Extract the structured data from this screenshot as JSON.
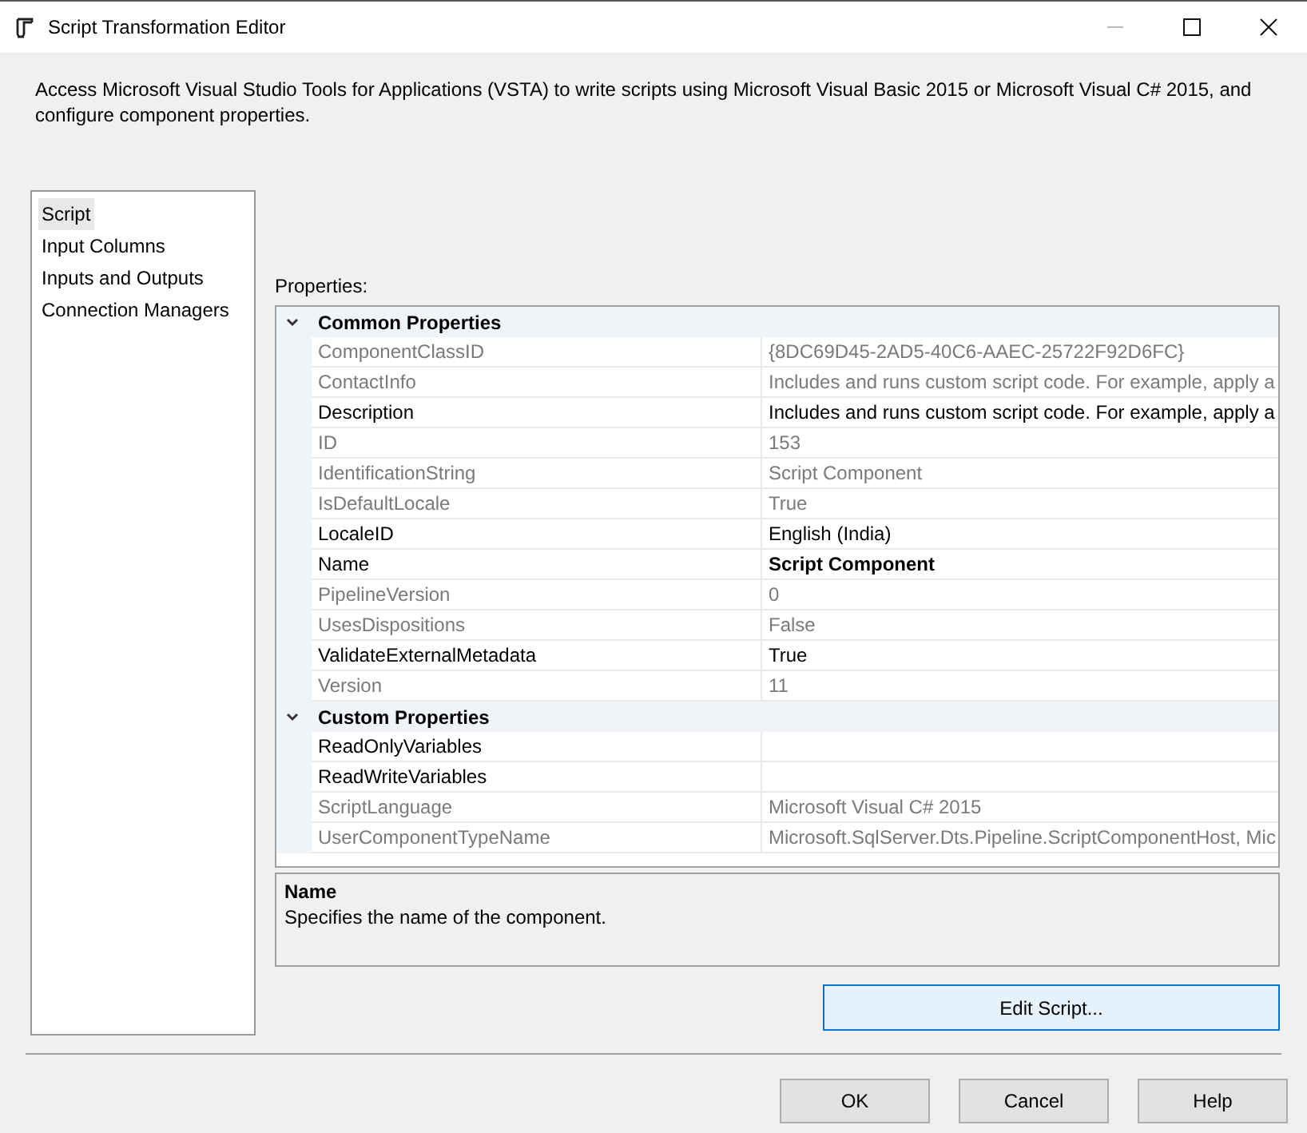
{
  "window": {
    "title": "Script Transformation Editor"
  },
  "description": "Access Microsoft Visual Studio Tools for Applications (VSTA) to write scripts using Microsoft Visual Basic 2015 or Microsoft Visual C# 2015, and configure component properties.",
  "sidebar": {
    "items": [
      {
        "label": "Script",
        "selected": true
      },
      {
        "label": "Input Columns",
        "selected": false
      },
      {
        "label": "Inputs and Outputs",
        "selected": false
      },
      {
        "label": "Connection Managers",
        "selected": false
      }
    ]
  },
  "properties": {
    "label": "Properties:",
    "sections": [
      {
        "title": "Common Properties",
        "expanded": true,
        "rows": [
          {
            "name": "ComponentClassID",
            "value": "{8DC69D45-2AD5-40C6-AAEC-25722F92D6FC}",
            "disabled": true,
            "bold": false
          },
          {
            "name": "ContactInfo",
            "value": "Includes and runs custom script code. For example, apply a",
            "disabled": true,
            "bold": false
          },
          {
            "name": "Description",
            "value": "Includes and runs custom script code. For example, apply a",
            "disabled": false,
            "bold": false
          },
          {
            "name": "ID",
            "value": "153",
            "disabled": true,
            "bold": false
          },
          {
            "name": "IdentificationString",
            "value": "Script Component",
            "disabled": true,
            "bold": false
          },
          {
            "name": "IsDefaultLocale",
            "value": "True",
            "disabled": true,
            "bold": false
          },
          {
            "name": "LocaleID",
            "value": "English (India)",
            "disabled": false,
            "bold": false
          },
          {
            "name": "Name",
            "value": "Script Component",
            "disabled": false,
            "bold": true
          },
          {
            "name": "PipelineVersion",
            "value": "0",
            "disabled": true,
            "bold": false
          },
          {
            "name": "UsesDispositions",
            "value": "False",
            "disabled": true,
            "bold": false
          },
          {
            "name": "ValidateExternalMetadata",
            "value": "True",
            "disabled": false,
            "bold": false
          },
          {
            "name": "Version",
            "value": "11",
            "disabled": true,
            "bold": false
          }
        ]
      },
      {
        "title": "Custom Properties",
        "expanded": true,
        "rows": [
          {
            "name": "ReadOnlyVariables",
            "disabled": false,
            "bold": false
          },
          {
            "name": "ReadWriteVariables",
            "disabled": false,
            "bold": false
          },
          {
            "name": "ScriptLanguage",
            "value": "Microsoft Visual C# 2015",
            "disabled": true,
            "bold": false
          },
          {
            "name": "UserComponentTypeName",
            "value": "Microsoft.SqlServer.Dts.Pipeline.ScriptComponentHost, Mic",
            "disabled": true,
            "bold": false
          }
        ]
      }
    ]
  },
  "help": {
    "title": "Name",
    "text": "Specifies the name of the component."
  },
  "edit_button": "Edit Script...",
  "buttons": [
    "OK",
    "Cancel",
    "Help"
  ]
}
